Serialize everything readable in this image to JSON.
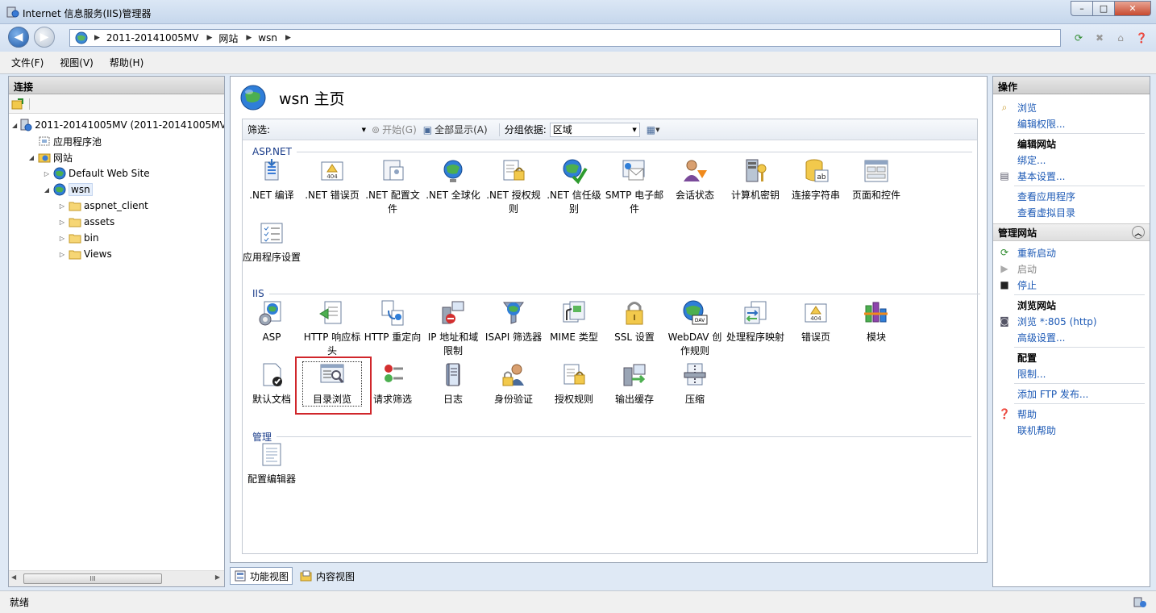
{
  "window": {
    "title": "Internet 信息服务(IIS)管理器",
    "buttons": {
      "minimize": "–",
      "maximize": "□",
      "close": "✕"
    }
  },
  "address": {
    "segments": [
      "2011-20141005MV",
      "网站",
      "wsn"
    ]
  },
  "menu": [
    "文件(F)",
    "视图(V)",
    "帮助(H)"
  ],
  "connections": {
    "title": "连接",
    "tree": [
      {
        "label": "2011-20141005MV (2011-20141005MV",
        "level": 0,
        "icon": "server-icon",
        "arrow": "◢"
      },
      {
        "label": "应用程序池",
        "level": 1,
        "icon": "app-pool-icon",
        "arrow": ""
      },
      {
        "label": "网站",
        "level": 1,
        "icon": "sites-folder-icon",
        "arrow": "◢"
      },
      {
        "label": "Default Web Site",
        "level": 2,
        "icon": "globe-icon",
        "arrow": "▷"
      },
      {
        "label": "wsn",
        "level": 2,
        "icon": "globe-icon",
        "arrow": "◢",
        "selected": true
      },
      {
        "label": "aspnet_client",
        "level": 3,
        "icon": "folder-icon",
        "arrow": "▷"
      },
      {
        "label": "assets",
        "level": 3,
        "icon": "folder-icon",
        "arrow": "▷"
      },
      {
        "label": "bin",
        "level": 3,
        "icon": "folder-icon",
        "arrow": "▷"
      },
      {
        "label": "Views",
        "level": 3,
        "icon": "folder-icon",
        "arrow": "▷"
      }
    ],
    "scroll_grip": "III"
  },
  "main": {
    "title": "wsn 主页",
    "filter": {
      "label": "筛选:",
      "go": "开始(G)",
      "show_all": "全部显示(A)",
      "group_label": "分组依据:",
      "group_value": "区域"
    },
    "sections": {
      "aspnet": "ASP.NET",
      "iis": "IIS",
      "manage": "管理"
    },
    "aspnet_tiles": [
      {
        "label": ".NET 编译",
        "icon": "net-compile-icon"
      },
      {
        "label": ".NET 错误页",
        "icon": "error-404-icon"
      },
      {
        "label": ".NET 配置文件",
        "icon": "net-profile-icon"
      },
      {
        "label": ".NET 全球化",
        "icon": "globalization-icon"
      },
      {
        "label": ".NET 授权规则",
        "icon": "authorization-icon"
      },
      {
        "label": ".NET 信任级别",
        "icon": "trust-level-icon"
      },
      {
        "label": "SMTP 电子邮件",
        "icon": "smtp-email-icon"
      },
      {
        "label": "会话状态",
        "icon": "session-state-icon"
      },
      {
        "label": "计算机密钥",
        "icon": "machine-key-icon"
      },
      {
        "label": "连接字符串",
        "icon": "connection-string-icon"
      },
      {
        "label": "页面和控件",
        "icon": "pages-controls-icon"
      },
      {
        "label": "应用程序设置",
        "icon": "app-settings-icon"
      }
    ],
    "iis_tiles": [
      {
        "label": "ASP",
        "icon": "asp-icon"
      },
      {
        "label": "HTTP 响应标头",
        "icon": "http-headers-icon"
      },
      {
        "label": "HTTP 重定向",
        "icon": "http-redirect-icon"
      },
      {
        "label": "IP 地址和域限制",
        "icon": "ip-restrictions-icon"
      },
      {
        "label": "ISAPI 筛选器",
        "icon": "isapi-filter-icon"
      },
      {
        "label": "MIME 类型",
        "icon": "mime-types-icon"
      },
      {
        "label": "SSL 设置",
        "icon": "ssl-lock-icon"
      },
      {
        "label": "WebDAV 创作规则",
        "icon": "webdav-icon"
      },
      {
        "label": "处理程序映射",
        "icon": "handler-mappings-icon"
      },
      {
        "label": "错误页",
        "icon": "error-page-icon"
      },
      {
        "label": "模块",
        "icon": "modules-icon"
      },
      {
        "label": "默认文档",
        "icon": "default-document-icon"
      },
      {
        "label": "目录浏览",
        "icon": "directory-browsing-icon",
        "selected": true
      },
      {
        "label": "请求筛选",
        "icon": "request-filtering-icon"
      },
      {
        "label": "日志",
        "icon": "logging-icon"
      },
      {
        "label": "身份验证",
        "icon": "authentication-icon"
      },
      {
        "label": "授权规则",
        "icon": "authorization-rules-icon"
      },
      {
        "label": "输出缓存",
        "icon": "output-cache-icon"
      },
      {
        "label": "压缩",
        "icon": "compression-icon"
      }
    ],
    "manage_tiles": [
      {
        "label": "配置编辑器",
        "icon": "config-editor-icon"
      }
    ],
    "tabs": {
      "features": "功能视图",
      "content": "内容视图"
    }
  },
  "actions": {
    "title": "操作",
    "items1": {
      "browse": "浏览",
      "edit_perms": "编辑权限..."
    },
    "edit_site": {
      "header": "编辑网站",
      "bindings": "绑定...",
      "basic": "基本设置...",
      "view_apps": "查看应用程序",
      "view_vdirs": "查看虚拟目录"
    },
    "manage_site": {
      "header": "管理网站",
      "restart": "重新启动",
      "start": "启动",
      "stop": "停止"
    },
    "browse_site": {
      "header": "浏览网站",
      "browse_link": "浏览 *:805 (http)",
      "advanced": "高级设置..."
    },
    "config": {
      "header": "配置",
      "limits": "限制..."
    },
    "ftp": "添加 FTP 发布...",
    "help": "帮助",
    "online_help": "联机帮助"
  },
  "status": {
    "text": "就绪"
  },
  "colors": {
    "link": "#1c59b5",
    "section": "#1b3d8a",
    "highlight": "#d0262b"
  }
}
